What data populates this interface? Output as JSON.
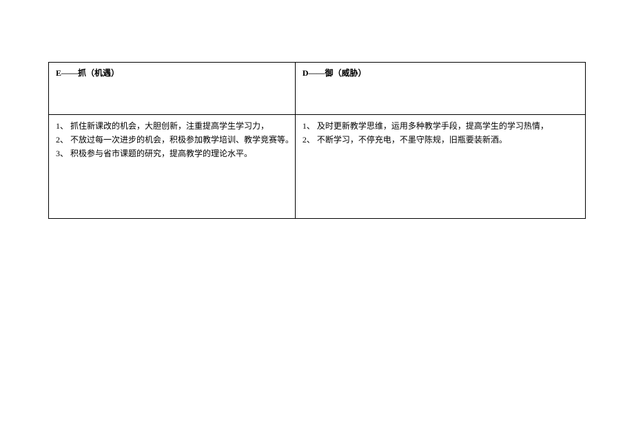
{
  "table": {
    "left": {
      "header": "E——抓（机遇）",
      "items": [
        "1、 抓住新课改的机会，大胆创新，注重提高学生学习力，",
        "2、 不放过每一次进步的机会，积极参加教学培训、教学竞赛等。",
        "3、 积极参与省市课题的研究，提高教学的理论水平。"
      ]
    },
    "right": {
      "header": "D——御（威胁）",
      "items": [
        "1、 及时更新教学思维，运用多种教学手段，提高学生的学习热情，",
        "2、 不断学习，不停充电，不墨守陈规，旧瓶要装新酒。"
      ]
    }
  }
}
